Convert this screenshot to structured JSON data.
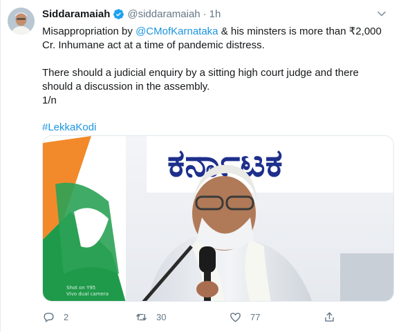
{
  "tweet": {
    "author_name": "Siddaramaiah",
    "author_handle": "@siddaramaiah",
    "separator": "·",
    "time": "1h",
    "text": {
      "line1_before": "Misappropriation by ",
      "mention": "@CMofKarnataka",
      "line1_after": " & his minsters is more than ₹2,000 Cr. Inhumane act at a time of pandemic distress.",
      "para2": "There should a judicial enquiry by a sitting high court judge and there should a discussion in the assembly.",
      "para3": "1/n",
      "hashtag": "#LekkaKodi"
    },
    "photo": {
      "banner_text": "ಕರ್ನಾಟಕ",
      "watermark_line1": "Shot on Y95",
      "watermark_line2": "Vivo dual camera"
    },
    "actions": {
      "replies": "2",
      "retweets": "30",
      "likes": "77"
    }
  },
  "colors": {
    "link": "#1b95e0",
    "muted": "#657786",
    "verified": "#1da1f2",
    "banner_blue": "#1e2f8c"
  },
  "icons": [
    "verified-badge-icon",
    "chevron-down-icon",
    "reply-icon",
    "retweet-icon",
    "like-icon",
    "share-icon"
  ]
}
